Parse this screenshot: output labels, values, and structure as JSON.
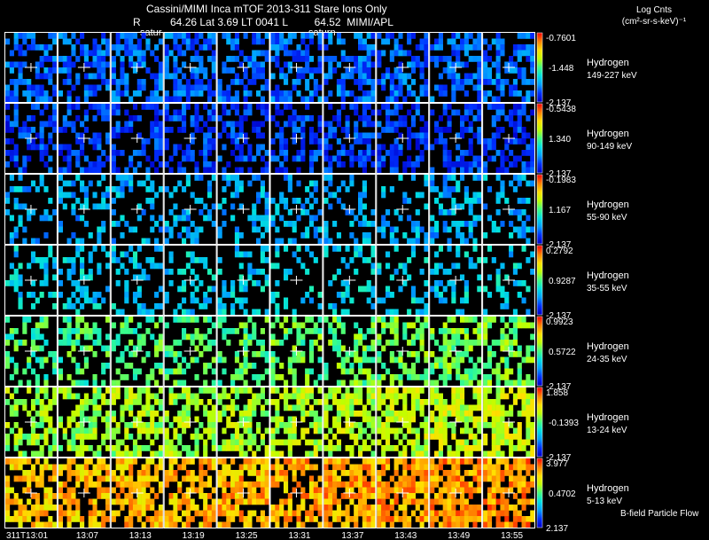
{
  "header": {
    "line1": "Cassini/MIMI Inca mTOF  2013-311    Stare   Ions Only",
    "line2": "R          64.26 Lat 3.69 LT 0041 L         64.52  MIMI/APL",
    "units_title": "Log Cnts",
    "units_sub": "(cm²-sr-s-keV)⁻¹",
    "overlay_labels": [
      "satur",
      "saturn"
    ]
  },
  "footer": {
    "time_labels": [
      "311T13:01",
      "13:07",
      "13:13",
      "13:19",
      "13:25",
      "13:31",
      "13:37",
      "13:43",
      "13:49",
      "13:55"
    ],
    "flow_label": "B-field Particle Flow"
  },
  "colors": {
    "background": "#000000",
    "grid_lines": "#ffffff",
    "colormap": [
      "#0000c8",
      "#0030ff",
      "#00a0ff",
      "#00e0e0",
      "#40ff80",
      "#c0ff00",
      "#ffe000",
      "#ff8000",
      "#ff0000"
    ]
  },
  "chart_data": {
    "type": "heatmap",
    "layout": "grid of image panels (energy channel rows x time columns)",
    "columns": 10,
    "rows": [
      {
        "species": "Hydrogen",
        "energy": "149-227 keV",
        "cmax": "-0.7601",
        "cmid": "-1.448",
        "cmin": "-2.137",
        "density": 0.55,
        "level": 0.18
      },
      {
        "species": "Hydrogen",
        "energy": "90-149 keV",
        "cmax": "-0.5438",
        "cmid": "1.340",
        "cmin": "-2.137",
        "density": 0.5,
        "level": 0.12
      },
      {
        "species": "Hydrogen",
        "energy": "55-90 keV",
        "cmax": "-0.1983",
        "cmid": "1.167",
        "cmin": "-2.137",
        "density": 0.32,
        "level": 0.28
      },
      {
        "species": "Hydrogen",
        "energy": "35-55 keV",
        "cmax": "0.2792",
        "cmid": "0.9287",
        "cmin": "-2.137",
        "density": 0.3,
        "level": 0.33
      },
      {
        "species": "Hydrogen",
        "energy": "24-35 keV",
        "cmax": "0.9923",
        "cmid": "0.5722",
        "cmin": "-2.137",
        "density": 0.38,
        "level": 0.48
      },
      {
        "species": "Hydrogen",
        "energy": "13-24 keV",
        "cmax": "1.858",
        "cmid": "-0.1393",
        "cmin": "-2.137",
        "density": 0.55,
        "level": 0.58
      },
      {
        "species": "Hydrogen",
        "energy": "5-13 keV",
        "cmax": "3.977",
        "cmid": "0.4702",
        "cmin": "2.137",
        "density": 0.62,
        "level": 0.78
      }
    ]
  }
}
